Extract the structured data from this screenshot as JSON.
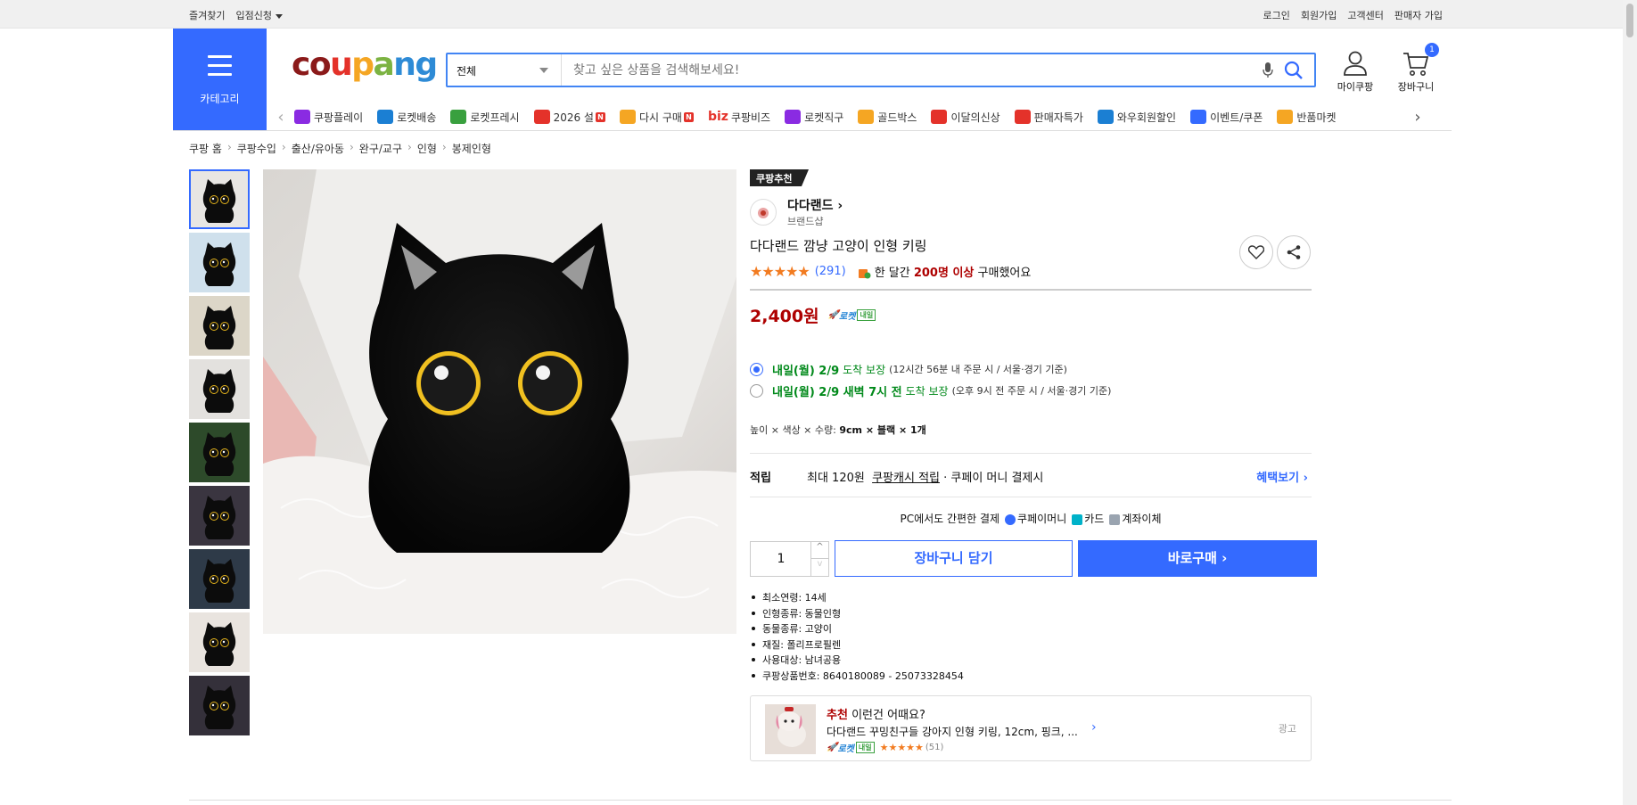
{
  "topbar": {
    "left": [
      "즐겨찾기",
      "입점신청"
    ],
    "right": [
      "로그인",
      "회원가입",
      "고객센터",
      "판매자 가입"
    ]
  },
  "header": {
    "category_label": "카테고리",
    "logo": "coupang",
    "search_select": "전체",
    "search_placeholder": "찾고 싶은 상품을 검색해보세요!",
    "mycoupang": "마이쿠팡",
    "cart": "장바구니",
    "cart_count": "1"
  },
  "nav": [
    {
      "label": "쿠팡플레이",
      "color": "#8a2be2"
    },
    {
      "label": "로켓배송",
      "color": "#1b7fd3"
    },
    {
      "label": "로켓프레시",
      "color": "#39a03e"
    },
    {
      "label": "2026 설",
      "color": "#e4322a",
      "badge": "N"
    },
    {
      "label": "다시 구매",
      "color": "#f5a623",
      "badge": "N"
    },
    {
      "label": "쿠팡비즈",
      "color": "#e4322a",
      "prefix": "biz"
    },
    {
      "label": "로켓직구",
      "color": "#8a2be2"
    },
    {
      "label": "골드박스",
      "color": "#f5a623"
    },
    {
      "label": "이달의신상",
      "color": "#e4322a"
    },
    {
      "label": "판매자특가",
      "color": "#e4322a"
    },
    {
      "label": "와우회원할인",
      "color": "#1b7fd3"
    },
    {
      "label": "이벤트/쿠폰",
      "color": "#346aff"
    },
    {
      "label": "반품마켓",
      "color": "#f5a623"
    }
  ],
  "breadcrumb": [
    "쿠팡 홈",
    "쿠팡수입",
    "출산/유아동",
    "완구/교구",
    "인형",
    "봉제인형"
  ],
  "product": {
    "rec_badge": "쿠팡추천",
    "brand": "다다랜드",
    "brand_sub": "브랜드샵",
    "title": "다다랜드 깜냥 고양이 인형 키링",
    "stars": "★★★★★",
    "review_count": "(291)",
    "monthly_pre": "한 달간",
    "monthly_bold": "200명 이상",
    "monthly_post": "구매했어요",
    "price": "2,400원",
    "rocket": "로켓",
    "rocket_tag": "내일",
    "delivery": [
      {
        "main": "내일(월) 2/9",
        "guarantee": "도착 보장",
        "note": "(12시간 56분 내 주문 시 / 서울·경기 기준)",
        "selected": true
      },
      {
        "main": "내일(월) 2/9 새벽 7시 전",
        "guarantee": "도착 보장",
        "note": "(오후 9시 전 주문 시 / 서울·경기 기준)",
        "selected": false
      }
    ],
    "option_label": "높이 × 색상 × 수량:",
    "option_value": "9cm × 블랙 × 1개",
    "points_label": "적립",
    "points_pre": "최대 120원",
    "points_link": "쿠팡캐시 적립",
    "points_post": "· 쿠페이 머니 결제시",
    "points_more": "혜택보기",
    "pay_title": "PC에서도 간편한 결제",
    "pay_methods": [
      {
        "label": "쿠페이머니",
        "color": "#346aff"
      },
      {
        "label": "카드",
        "color": "#00b2c9"
      },
      {
        "label": "계좌이체",
        "color": "#9aa4b0"
      }
    ],
    "qty": "1",
    "add_cart": "장바구니 담기",
    "buy_now": "바로구매",
    "attributes": [
      "최소연령: 14세",
      "인형종류: 동물인형",
      "동물종류: 고양이",
      "재질: 폴리프로필렌",
      "사용대상: 남녀공용",
      "쿠팡상품번호: 8640180089 - 25073328454"
    ]
  },
  "recommend": {
    "head_red": "추천",
    "head_rest": "이런건 어때요?",
    "title": "다다랜드 꾸밍친구들 강아지 인형 키링, 12cm, 핑크, ...",
    "rocket": "로켓",
    "rocket_tag": "내일",
    "stars": "★★★★★",
    "count": "(51)",
    "ad": "광고"
  }
}
